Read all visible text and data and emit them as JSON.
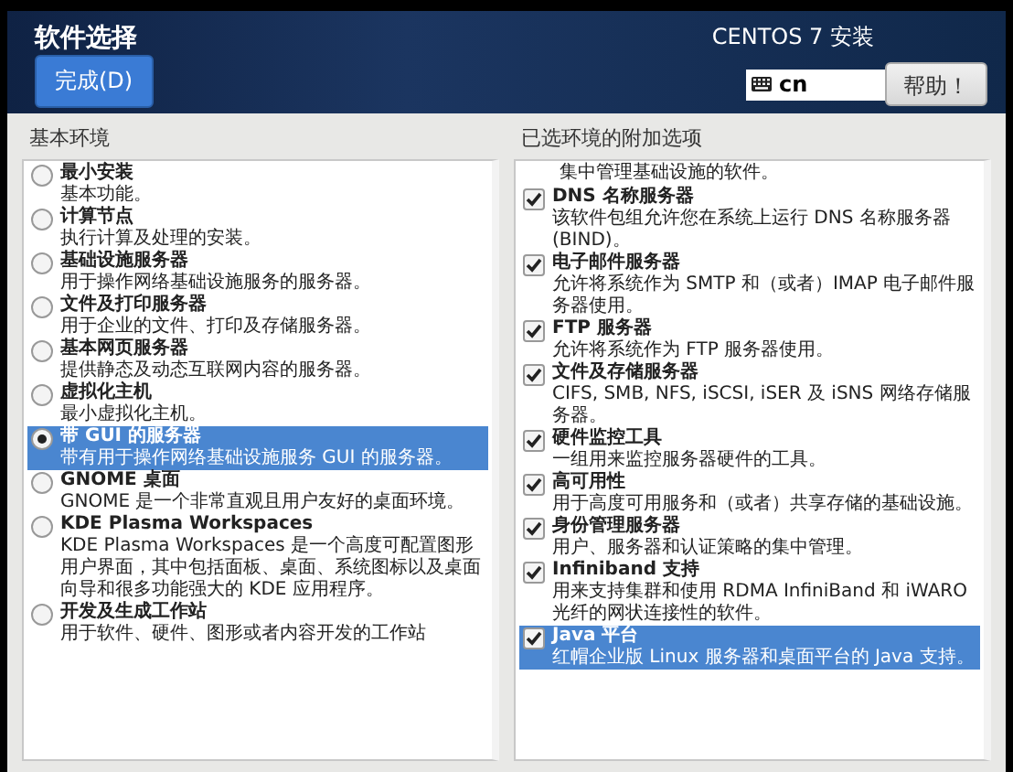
{
  "header": {
    "title": "软件选择",
    "done_button": "完成(D)",
    "product": "CENTOS 7 安装",
    "keyboard_layout": "cn",
    "help_button": "帮助！"
  },
  "base_environment": {
    "heading": "基本环境",
    "items": [
      {
        "name": "最小安装",
        "description": "基本功能。",
        "selected": false
      },
      {
        "name": "计算节点",
        "description": "执行计算及处理的安装。",
        "selected": false
      },
      {
        "name": "基础设施服务器",
        "description": "用于操作网络基础设施服务的服务器。",
        "selected": false
      },
      {
        "name": "文件及打印服务器",
        "description": "用于企业的文件、打印及存储服务器。",
        "selected": false
      },
      {
        "name": "基本网页服务器",
        "description": "提供静态及动态互联网内容的服务器。",
        "selected": false
      },
      {
        "name": "虚拟化主机",
        "description": "最小虚拟化主机。",
        "selected": false
      },
      {
        "name": "带 GUI 的服务器",
        "description": "带有用于操作网络基础设施服务 GUI 的服务器。",
        "selected": true
      },
      {
        "name": "GNOME 桌面",
        "description": "GNOME 是一个非常直观且用户友好的桌面环境。",
        "selected": false
      },
      {
        "name": "KDE Plasma Workspaces",
        "description": "KDE Plasma Workspaces 是一个高度可配置图形用户界面，其中包括面板、桌面、系统图标以及桌面向导和很多功能强大的 KDE 应用程序。",
        "selected": false
      },
      {
        "name": "开发及生成工作站",
        "description": "用于软件、硬件、图形或者内容开发的工作站",
        "selected": false
      }
    ]
  },
  "addons": {
    "heading": "已选环境的附加选项",
    "items": [
      {
        "kind": "continuation",
        "description": "集中管理基础设施的软件。"
      },
      {
        "kind": "option",
        "name": "DNS 名称服务器",
        "description": "该软件包组允许您在系统上运行 DNS 名称服务器 (BIND)。",
        "checked": true,
        "selected": false
      },
      {
        "kind": "option",
        "name": "电子邮件服务器",
        "description": "允许将系统作为 SMTP 和（或者）IMAP 电子邮件服务器使用。",
        "checked": true,
        "selected": false
      },
      {
        "kind": "option",
        "name": "FTP 服务器",
        "description": "允许将系统作为 FTP 服务器使用。",
        "checked": true,
        "selected": false
      },
      {
        "kind": "option",
        "name": "文件及存储服务器",
        "description": "CIFS, SMB, NFS, iSCSI, iSER 及 iSNS 网络存储服务器。",
        "checked": true,
        "selected": false
      },
      {
        "kind": "option",
        "name": "硬件监控工具",
        "description": "一组用来监控服务器硬件的工具。",
        "checked": true,
        "selected": false
      },
      {
        "kind": "option",
        "name": "高可用性",
        "description": "用于高度可用服务和（或者）共享存储的基础设施。",
        "checked": true,
        "selected": false
      },
      {
        "kind": "option",
        "name": "身份管理服务器",
        "description": "用户、服务器和认证策略的集中管理。",
        "checked": true,
        "selected": false
      },
      {
        "kind": "option",
        "name": "Infiniband 支持",
        "description": "用来支持集群和使用 RDMA InfiniBand 和 iWARO 光纤的网状连接性的软件。",
        "checked": true,
        "selected": false
      },
      {
        "kind": "option",
        "name": "Java 平台",
        "description": "红帽企业版 Linux 服务器和桌面平台的 Java 支持。",
        "checked": true,
        "selected": true
      }
    ]
  }
}
